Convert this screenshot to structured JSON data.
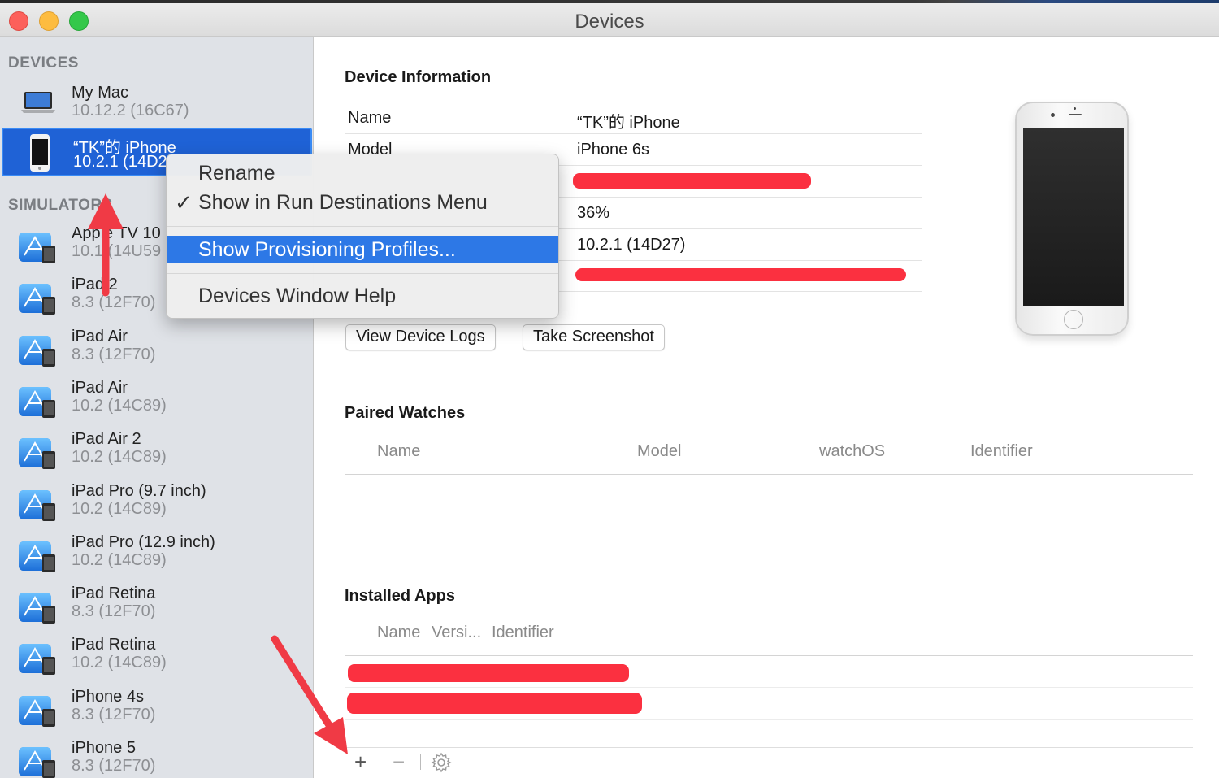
{
  "window": {
    "title": "Devices"
  },
  "sidebar": {
    "devices_heading": "DEVICES",
    "simulators_heading": "SIMULATORS",
    "devices": [
      {
        "name": "My Mac",
        "version": "10.12.2 (16C67)",
        "icon": "mac-laptop-icon"
      },
      {
        "name": "“TK”的 iPhone",
        "version": "10.2.1 (14D2",
        "icon": "iphone-device-icon"
      }
    ],
    "simulators": [
      {
        "name": "Apple TV 10",
        "version": "10.1 (14U59"
      },
      {
        "name": "iPad 2",
        "version": "8.3 (12F70)"
      },
      {
        "name": "iPad Air",
        "version": "8.3 (12F70)"
      },
      {
        "name": "iPad Air",
        "version": "10.2 (14C89)"
      },
      {
        "name": "iPad Air 2",
        "version": "10.2 (14C89)"
      },
      {
        "name": "iPad Pro (9.7 inch)",
        "version": "10.2 (14C89)"
      },
      {
        "name": "iPad Pro (12.9 inch)",
        "version": "10.2 (14C89)"
      },
      {
        "name": "iPad Retina",
        "version": "8.3 (12F70)"
      },
      {
        "name": "iPad Retina",
        "version": "10.2 (14C89)"
      },
      {
        "name": "iPhone 4s",
        "version": "8.3 (12F70)"
      },
      {
        "name": "iPhone 5",
        "version": "8.3 (12F70)"
      }
    ]
  },
  "device_info": {
    "heading": "Device Information",
    "rows": [
      {
        "label": "Name",
        "value": "“TK”的 iPhone"
      },
      {
        "label": "Model",
        "value": "iPhone 6s"
      },
      {
        "label": "",
        "value": ""
      },
      {
        "label": "",
        "value": "36%"
      },
      {
        "label": "",
        "value": "10.2.1 (14D27)"
      },
      {
        "label": "",
        "value": ""
      }
    ],
    "buttons": {
      "view_logs": "View Device Logs",
      "screenshot": "Take Screenshot"
    }
  },
  "paired_watches": {
    "heading": "Paired Watches",
    "columns": [
      "Name",
      "Model",
      "watchOS",
      "Identifier"
    ]
  },
  "installed_apps": {
    "heading": "Installed Apps",
    "columns": [
      "Name",
      "Versi...",
      "Identifier"
    ]
  },
  "bottom_bar": {
    "add": "+",
    "remove": "−",
    "settings_icon": "gear-icon"
  },
  "context_menu": {
    "items": [
      {
        "label": "Rename",
        "checked": false
      },
      {
        "label": "Show in Run Destinations Menu",
        "checked": true
      },
      {
        "label": "Show Provisioning Profiles...",
        "highlighted": true
      },
      {
        "label": "Devices Window Help"
      }
    ],
    "check_glyph": "✓"
  },
  "colors": {
    "selection": "#1f62d6",
    "menu_highlight": "#2d78e6",
    "redaction": "#fb3040",
    "annotation_arrow": "#f03a45"
  }
}
